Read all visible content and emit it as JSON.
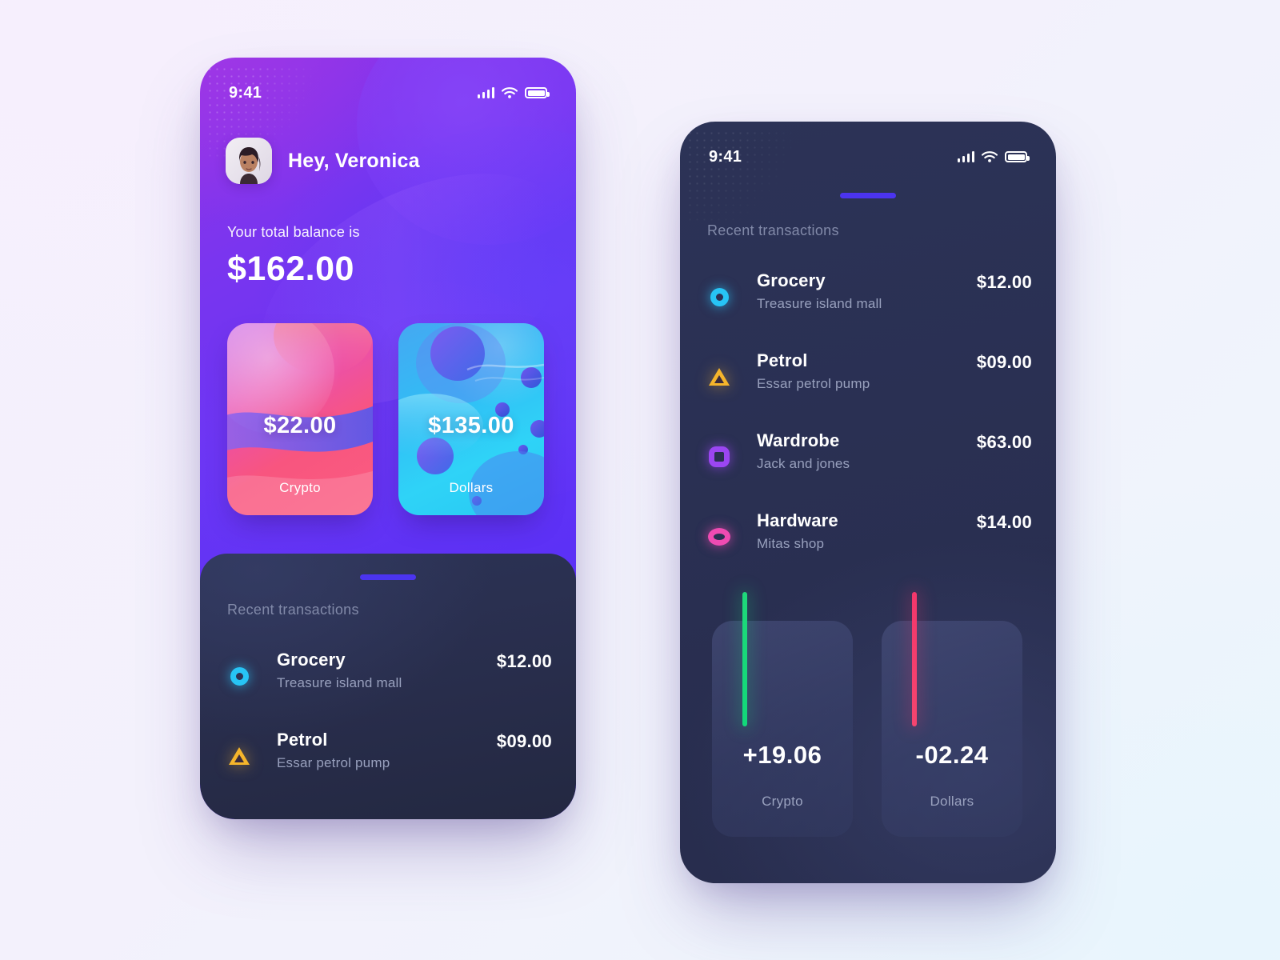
{
  "page": {
    "background_start": "#f5f0fd",
    "background_end": "#edf6fc"
  },
  "screen_home": {
    "accent_purple": "#5c31f6",
    "status_bar": {
      "time": "9:41",
      "icons": [
        "signal-icon",
        "wifi-icon",
        "battery-icon"
      ]
    },
    "greeting": "Hey, Veronica",
    "avatar_alt": "user-avatar",
    "balance_label": "Your total balance is",
    "balance_value": "$162.00",
    "wallet_cards": [
      {
        "amount": "$22.00",
        "label": "Crypto",
        "color": "#f8557f"
      },
      {
        "amount": "$135.00",
        "label": "Dollars",
        "color": "#2fd3f7"
      }
    ],
    "sheet": {
      "grabber": "drag-handle",
      "title": "Recent transactions",
      "transactions": [
        {
          "icon": "ring-icon",
          "icon_color": "#27c4f5",
          "title": "Grocery",
          "subtitle": "Treasure island mall",
          "amount": "$12.00"
        },
        {
          "icon": "triangle-icon",
          "icon_color": "#f5b52b",
          "title": "Petrol",
          "subtitle": "Essar petrol pump",
          "amount": "$09.00"
        }
      ]
    }
  },
  "screen_transactions": {
    "background": "#2a3053",
    "status_bar": {
      "time": "9:41",
      "icons": [
        "signal-icon",
        "wifi-icon",
        "battery-icon"
      ]
    },
    "grabber": "drag-handle",
    "title": "Recent transactions",
    "transactions": [
      {
        "icon": "ring-icon",
        "icon_color": "#27c4f5",
        "title": "Grocery",
        "subtitle": "Treasure island mall",
        "amount": "$12.00"
      },
      {
        "icon": "triangle-icon",
        "icon_color": "#f5b52b",
        "title": "Petrol",
        "subtitle": "Essar petrol pump",
        "amount": "$09.00"
      },
      {
        "icon": "square-icon",
        "icon_color": "#9b46f2",
        "title": "Wardrobe",
        "subtitle": "Jack and jones",
        "amount": "$63.00"
      },
      {
        "icon": "ellipse-icon",
        "icon_color": "#ef4bb2",
        "title": "Hardware",
        "subtitle": "Mitas shop",
        "amount": "$14.00"
      }
    ],
    "stats": [
      {
        "value": "+19.06",
        "label": "Crypto",
        "direction": "positive",
        "color": "#12d87a"
      },
      {
        "value": "-02.24",
        "label": "Dollars",
        "direction": "negative",
        "color": "#f4376b"
      }
    ]
  }
}
